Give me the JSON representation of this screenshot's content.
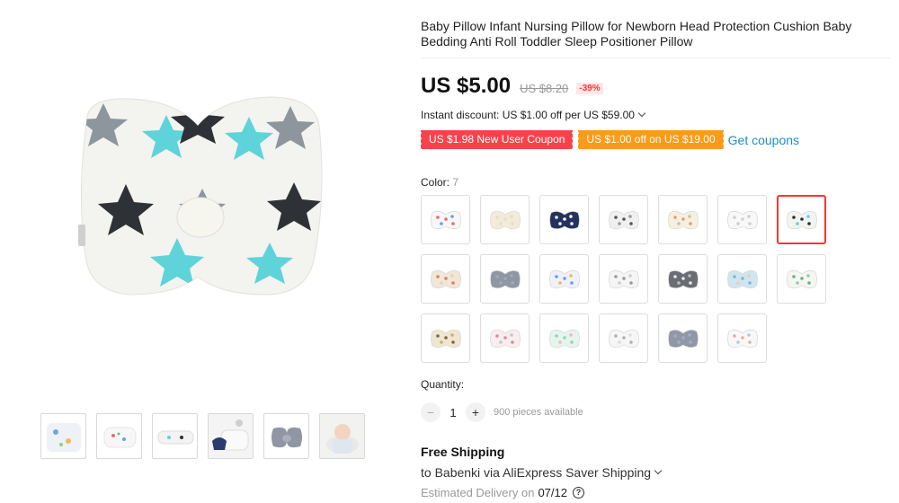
{
  "product": {
    "title": "Baby Pillow Infant Nursing Pillow for Newborn Head Protection Cushion Baby Bedding Anti Roll Toddler Sleep Positioner Pillow"
  },
  "price": {
    "current": "US $5.00",
    "original": "US $8.20",
    "discount": "-39%"
  },
  "instant_discount": "Instant discount: US $1.00 off per US $59.00",
  "coupons": {
    "new_user": "US $1.98 New User Coupon",
    "store": "US $1.00 off on US $19.00",
    "get_label": "Get coupons"
  },
  "color": {
    "label": "Color:",
    "count": "7",
    "selected_index": 6,
    "options": [
      "multicolor-print",
      "cream-plain",
      "navy-whales",
      "gray-cars",
      "cream-dots",
      "white-floral",
      "cyan-stars",
      "beige-animals",
      "gray-plain",
      "blue-mix-print",
      "white-bear",
      "gray-elephants",
      "blue-bear",
      "white-leaves",
      "beige-giraffe",
      "pink-stripes",
      "mint-floral",
      "white-bear-2",
      "gray-plain-2",
      "white-print"
    ]
  },
  "quantity": {
    "label": "Quantity:",
    "value": "1",
    "minus": "−",
    "plus": "+",
    "stock": "900 pieces available"
  },
  "shipping": {
    "title": "Free Shipping",
    "to": "to Babenki via AliExpress Saver Shipping",
    "delivery_label": "Estimated Delivery on",
    "delivery_date": "07/12",
    "help_glyph": "?"
  },
  "colors": {
    "accent_red": "#f8424b",
    "accent_orange": "#fc9a19",
    "link_blue": "#1a8fc8",
    "star_cyan": "#5fd3da",
    "star_dark": "#2e3136",
    "star_gray": "#8e969d"
  },
  "thumbnails": [
    "pillow-set",
    "pillow-print",
    "pillow-side",
    "pillow-hand",
    "pillow-gray",
    "baby-on-pillow"
  ]
}
